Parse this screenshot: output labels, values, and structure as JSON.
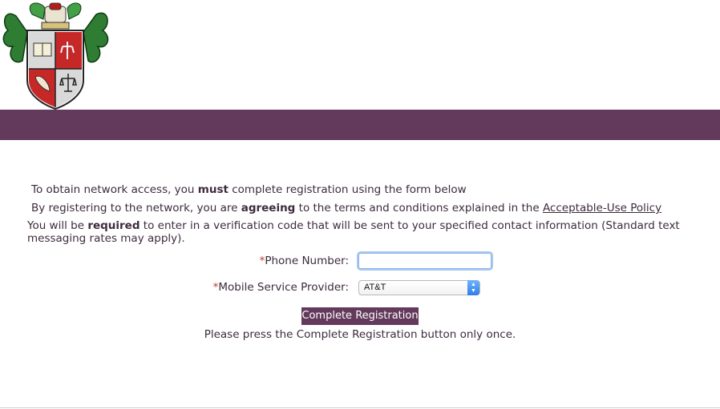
{
  "intro": {
    "line1_pre": "To obtain network access, you ",
    "line1_bold": "must",
    "line1_post": " complete registration using the form below",
    "line2_pre": "By registering to the network, you are ",
    "line2_bold": "agreeing",
    "line2_mid": " to the terms and conditions explained in the ",
    "line2_link": "Acceptable-Use Policy",
    "line3_pre": "You will be ",
    "line3_bold": "required",
    "line3_post": " to enter in a verification code that will be sent to your specified contact information (Standard text messaging rates may apply)."
  },
  "form": {
    "required_mark": "*",
    "phone_label": "Phone Number:",
    "phone_value": "",
    "provider_label": "Mobile Service Provider:",
    "provider_value": "AT&T",
    "submit_label": "Complete Registration",
    "notice": "Please press the Complete Registration button only once."
  },
  "colors": {
    "brand": "#633a5b",
    "text": "#3d2b3d",
    "required": "#c0392b"
  },
  "icons": {
    "crest": "coat-of-arms-icon",
    "select_arrows": "select-arrows-icon"
  }
}
